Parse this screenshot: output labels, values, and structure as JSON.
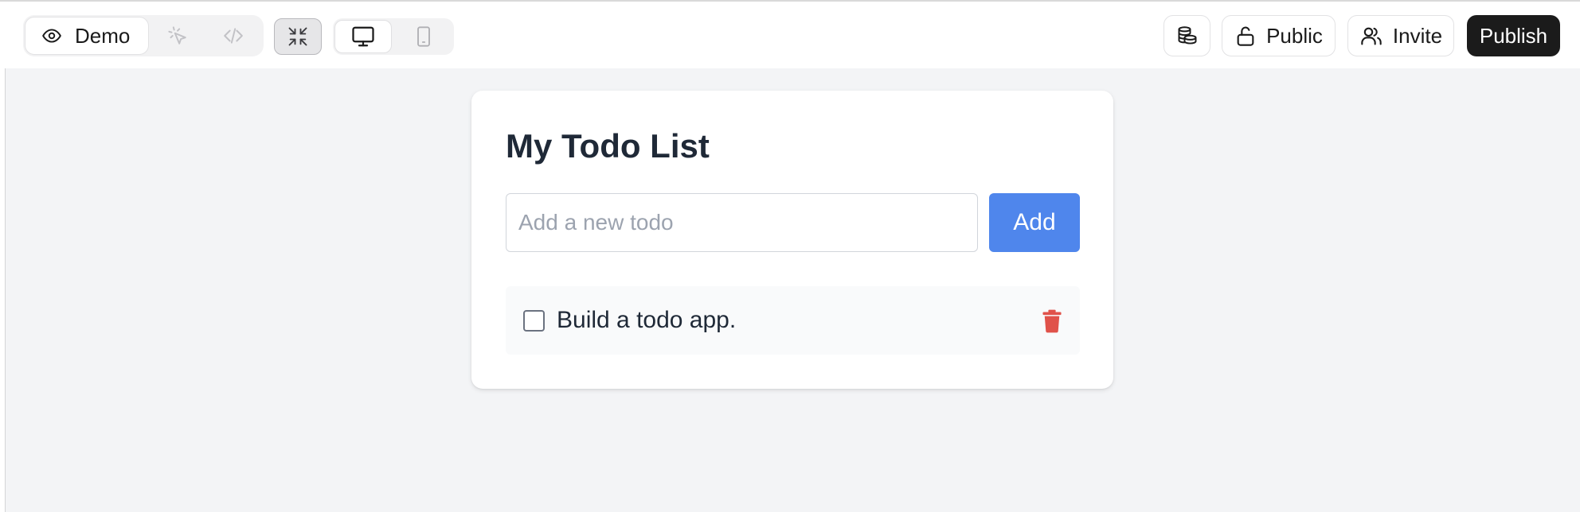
{
  "toolbar": {
    "mode_demo_label": "Demo",
    "right": {
      "public_label": "Public",
      "invite_label": "Invite",
      "publish_label": "Publish"
    }
  },
  "icons": {
    "demo": "eye-icon",
    "select": "cursor-click-icon",
    "code": "code-icon",
    "collapse": "collapse-arrows-icon",
    "desktop": "monitor-icon",
    "mobile": "phone-icon",
    "database": "database-icon",
    "public": "unlock-icon",
    "invite": "users-icon",
    "delete": "trash-icon"
  },
  "app": {
    "title": "My Todo List",
    "input_placeholder": "Add a new todo",
    "input_value": "",
    "add_label": "Add",
    "todos": [
      {
        "text": "Build a todo app.",
        "done": false
      }
    ]
  },
  "colors": {
    "accent": "#4f86ec",
    "publish_bg": "#1b1b1b",
    "delete": "#e0524a",
    "preview_bg": "#f3f4f6"
  }
}
